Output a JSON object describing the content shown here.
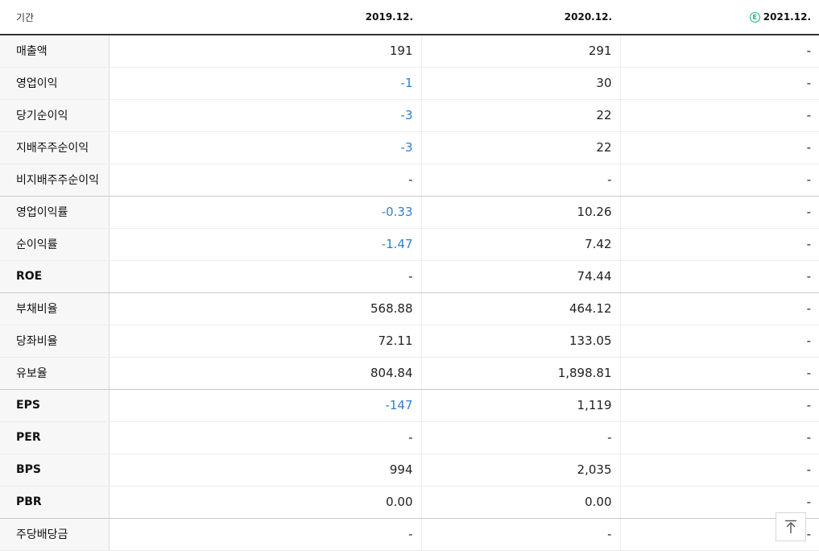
{
  "header": {
    "period_label": "기간",
    "years": [
      "2019.12.",
      "2020.12.",
      "2021.12."
    ],
    "estimate_badge": "E"
  },
  "rows": [
    {
      "label": "매출액",
      "values": [
        "191",
        "291",
        "-"
      ],
      "neg": [
        false,
        false,
        false
      ]
    },
    {
      "label": "영업이익",
      "values": [
        "-1",
        "30",
        "-"
      ],
      "neg": [
        true,
        false,
        false
      ]
    },
    {
      "label": "당기순이익",
      "values": [
        "-3",
        "22",
        "-"
      ],
      "neg": [
        true,
        false,
        false
      ]
    },
    {
      "label": "지배주주순이익",
      "values": [
        "-3",
        "22",
        "-"
      ],
      "neg": [
        true,
        false,
        false
      ]
    },
    {
      "label": "비지배주주순이익",
      "values": [
        "-",
        "-",
        "-"
      ],
      "neg": [
        false,
        false,
        false
      ]
    },
    {
      "label": "영업이익률",
      "values": [
        "-0.33",
        "10.26",
        "-"
      ],
      "neg": [
        true,
        false,
        false
      ]
    },
    {
      "label": "순이익률",
      "values": [
        "-1.47",
        "7.42",
        "-"
      ],
      "neg": [
        true,
        false,
        false
      ]
    },
    {
      "label": "ROE",
      "values": [
        "-",
        "74.44",
        "-"
      ],
      "neg": [
        false,
        false,
        false
      ]
    },
    {
      "label": "부채비율",
      "values": [
        "568.88",
        "464.12",
        "-"
      ],
      "neg": [
        false,
        false,
        false
      ]
    },
    {
      "label": "당좌비율",
      "values": [
        "72.11",
        "133.05",
        "-"
      ],
      "neg": [
        false,
        false,
        false
      ]
    },
    {
      "label": "유보율",
      "values": [
        "804.84",
        "1,898.81",
        "-"
      ],
      "neg": [
        false,
        false,
        false
      ]
    },
    {
      "label": "EPS",
      "values": [
        "-147",
        "1,119",
        "-"
      ],
      "neg": [
        true,
        false,
        false
      ]
    },
    {
      "label": "PER",
      "values": [
        "-",
        "-",
        "-"
      ],
      "neg": [
        false,
        false,
        false
      ]
    },
    {
      "label": "BPS",
      "values": [
        "994",
        "2,035",
        "-"
      ],
      "neg": [
        false,
        false,
        false
      ]
    },
    {
      "label": "PBR",
      "values": [
        "0.00",
        "0.00",
        "-"
      ],
      "neg": [
        false,
        false,
        false
      ]
    },
    {
      "label": "주당배당금",
      "values": [
        "-",
        "-",
        "-"
      ],
      "neg": [
        false,
        false,
        false
      ]
    }
  ],
  "colors": {
    "negative": "#2f7fd1",
    "estimate_badge": "#1fb27a"
  },
  "icons": {
    "scroll_top": "arrow-up-to-top-icon"
  }
}
